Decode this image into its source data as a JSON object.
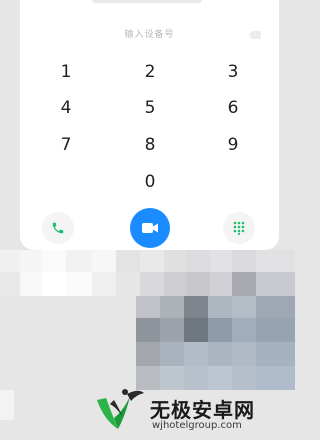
{
  "dialer": {
    "input_placeholder": "输入设备号",
    "keys": [
      "1",
      "2",
      "3",
      "4",
      "5",
      "6",
      "7",
      "8",
      "9",
      "0"
    ],
    "actions": {
      "call_icon": "phone-icon",
      "video_icon": "video-camera-icon",
      "keypad_icon": "dialpad-icon"
    }
  },
  "colors": {
    "accent": "#1b8cff",
    "call_green": "#1dbf6e"
  },
  "watermark": {
    "title": "无极安卓网",
    "url": "wjhotelgroup.com"
  }
}
